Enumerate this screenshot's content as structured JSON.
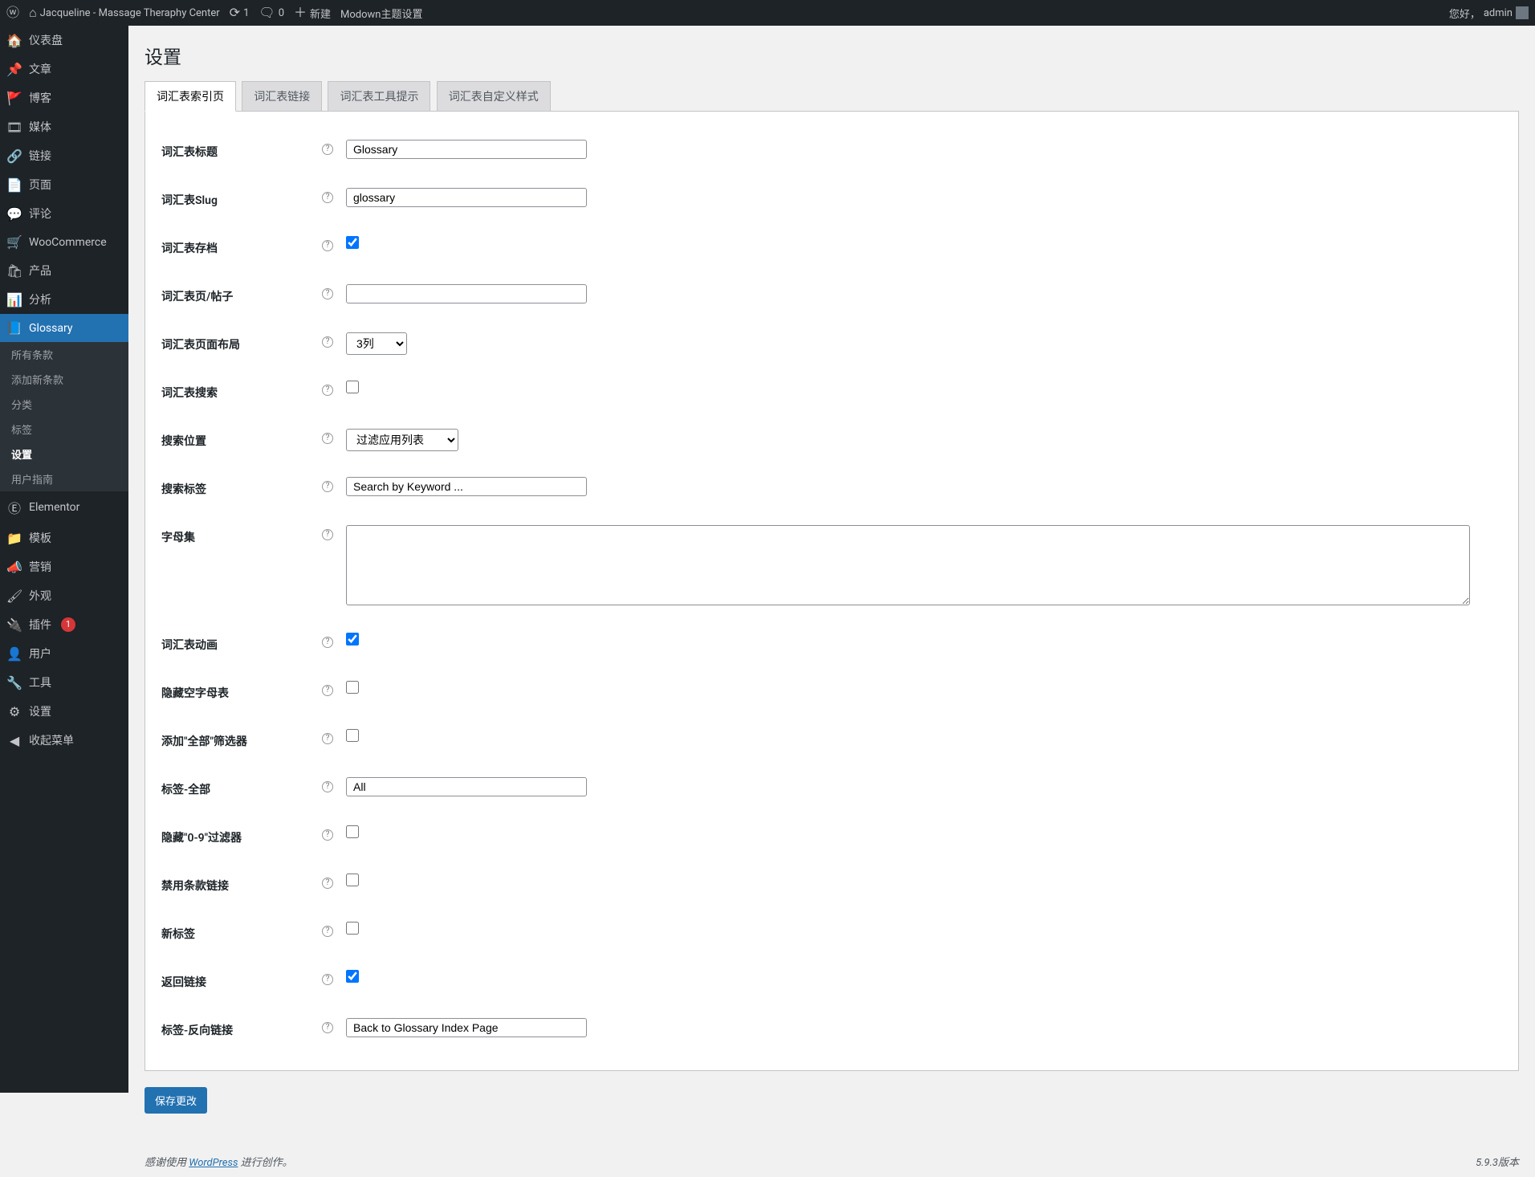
{
  "adminbar": {
    "site_name": "Jacqueline - Massage Theraphy Center",
    "updates_count": "1",
    "comments_count": "0",
    "new_label": "新建",
    "theme_options_label": "Modown主题设置",
    "greeting": "您好，",
    "user": "admin"
  },
  "menu": {
    "items": [
      {
        "icon": "🏠",
        "label": "仪表盘"
      },
      {
        "icon": "📌",
        "label": "文章"
      },
      {
        "icon": "🚩",
        "label": "博客"
      },
      {
        "icon": "🎞",
        "label": "媒体"
      },
      {
        "icon": "🔗",
        "label": "链接"
      },
      {
        "icon": "📄",
        "label": "页面"
      },
      {
        "icon": "💬",
        "label": "评论"
      },
      {
        "icon": "🛒",
        "label": "WooCommerce"
      },
      {
        "icon": "🛍",
        "label": "产品"
      },
      {
        "icon": "📊",
        "label": "分析"
      },
      {
        "icon": "📘",
        "label": "Glossary"
      },
      {
        "icon": "Ⓔ",
        "label": "Elementor"
      },
      {
        "icon": "📁",
        "label": "模板"
      },
      {
        "icon": "📣",
        "label": "营销"
      },
      {
        "icon": "🖌",
        "label": "外观"
      },
      {
        "icon": "🔌",
        "label": "插件"
      },
      {
        "icon": "👤",
        "label": "用户"
      },
      {
        "icon": "🔧",
        "label": "工具"
      },
      {
        "icon": "⚙",
        "label": "设置"
      },
      {
        "icon": "◀",
        "label": "收起菜单"
      }
    ],
    "plugins_update": "1",
    "glossary_sub": [
      {
        "label": "所有条款"
      },
      {
        "label": "添加新条款"
      },
      {
        "label": "分类"
      },
      {
        "label": "标签"
      },
      {
        "label": "设置"
      },
      {
        "label": "用户指南"
      }
    ]
  },
  "page": {
    "title": "设置",
    "tabs": [
      {
        "label": "词汇表索引页"
      },
      {
        "label": "词汇表链接"
      },
      {
        "label": "词汇表工具提示"
      },
      {
        "label": "词汇表自定义样式"
      }
    ]
  },
  "fields": {
    "title": {
      "label": "词汇表标题",
      "value": "Glossary"
    },
    "slug": {
      "label": "词汇表Slug",
      "value": "glossary"
    },
    "archive": {
      "label": "词汇表存档",
      "checked": true
    },
    "page_post": {
      "label": "词汇表页/帖子",
      "value": ""
    },
    "layout": {
      "label": "词汇表页面布局",
      "value": "3列"
    },
    "search": {
      "label": "词汇表搜索",
      "checked": false
    },
    "search_position": {
      "label": "搜索位置",
      "value": "过滤应用列表"
    },
    "search_label": {
      "label": "搜索标签",
      "value": "Search by Keyword ..."
    },
    "alphabets": {
      "label": "字母集",
      "value": ""
    },
    "animation": {
      "label": "词汇表动画",
      "checked": true
    },
    "hide_empty": {
      "label": "隐藏空字母表",
      "checked": false
    },
    "add_all_filter": {
      "label": "添加\"全部\"筛选器",
      "checked": false
    },
    "label_all": {
      "label": "标签-全部",
      "value": "All"
    },
    "hide_09": {
      "label": "隐藏\"0-9\"过滤器",
      "checked": false
    },
    "disable_term_link": {
      "label": "禁用条款链接",
      "checked": false
    },
    "new_tab": {
      "label": "新标签",
      "checked": false
    },
    "back_link": {
      "label": "返回链接",
      "checked": true
    },
    "label_back": {
      "label": "标签-反向链接",
      "value": "Back to Glossary Index Page"
    }
  },
  "save_button": "保存更改",
  "footer": {
    "thanks_prefix": "感谢使用",
    "wp_label": "WordPress",
    "thanks_suffix": "进行创作。",
    "version": "5.9.3版本"
  }
}
